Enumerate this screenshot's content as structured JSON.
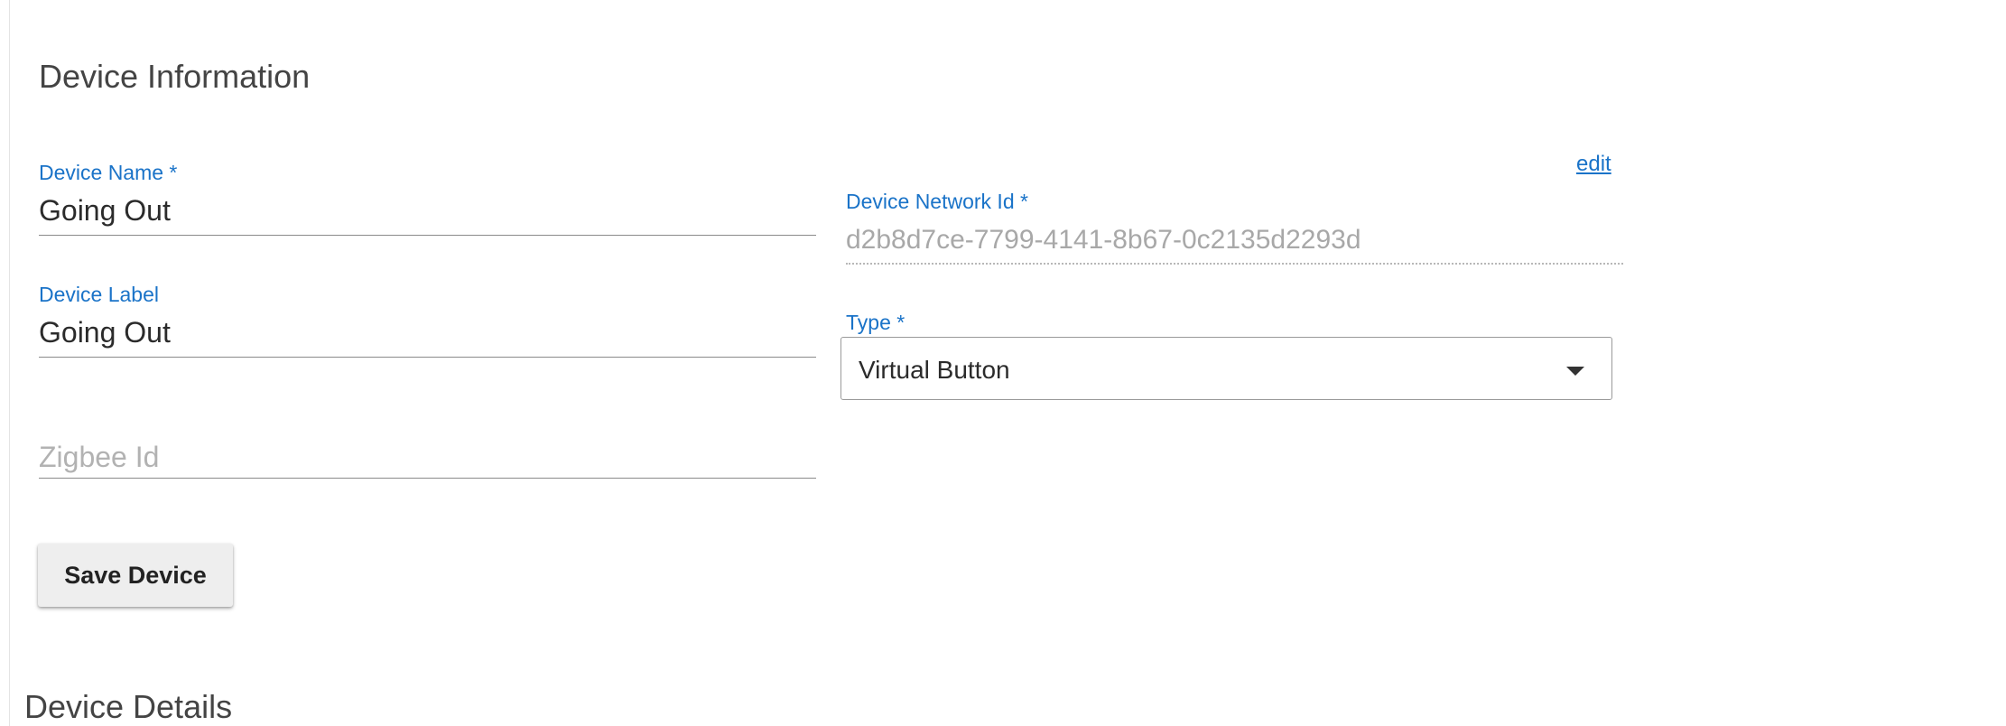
{
  "section": {
    "title": "Device Information"
  },
  "fields": {
    "device_name": {
      "label": "Device Name *",
      "value": "Going Out"
    },
    "device_label": {
      "label": "Device Label",
      "value": "Going Out"
    },
    "zigbee_id": {
      "placeholder": "Zigbee Id",
      "value": ""
    },
    "device_network_id": {
      "label": "Device Network Id *",
      "value": "d2b8d7ce-7799-4141-8b67-0c2135d2293d",
      "edit_label": "edit"
    },
    "type": {
      "label": "Type *",
      "selected": "Virtual Button"
    }
  },
  "actions": {
    "save_label": "Save Device"
  },
  "details": {
    "title": "Device Details"
  },
  "colors": {
    "accent": "#1a73c8",
    "button_bg": "#eeeeee"
  }
}
